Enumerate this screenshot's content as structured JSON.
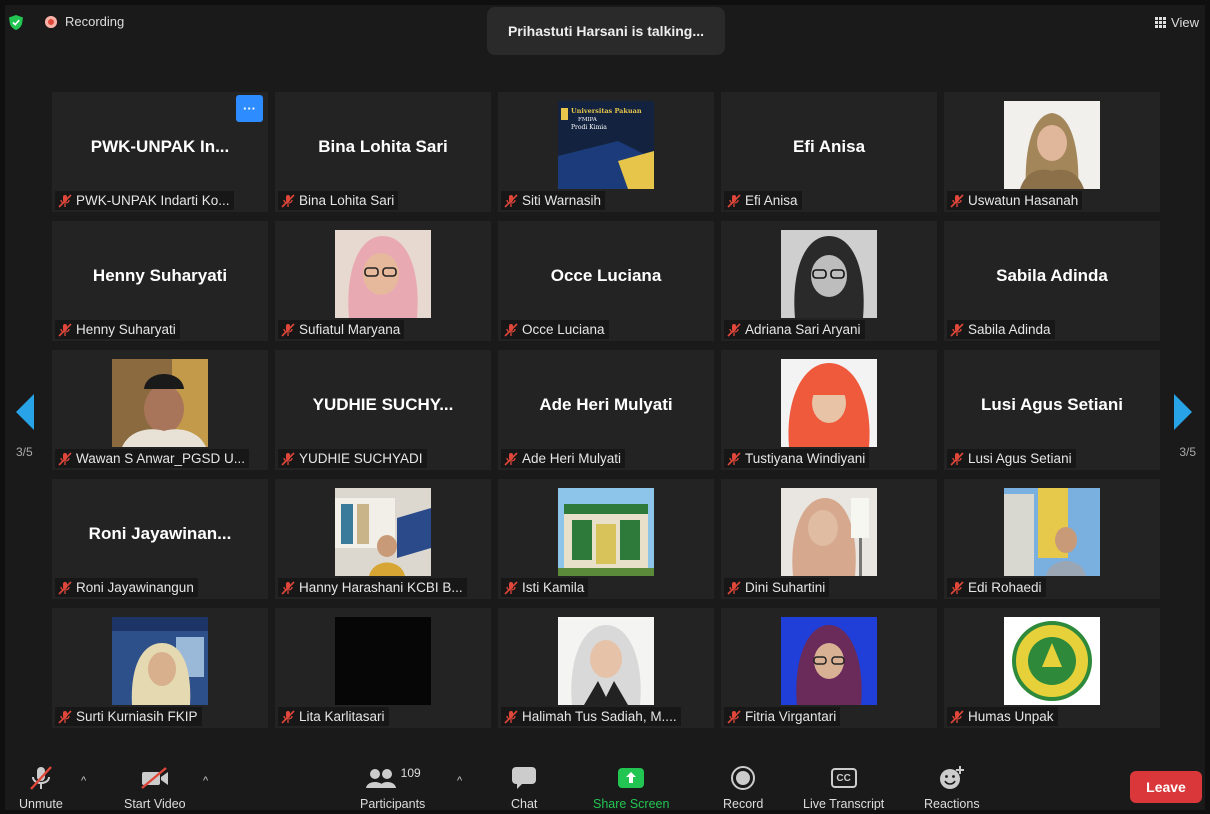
{
  "window": {
    "recording_label": "Recording",
    "speaker_banner": "Prihastuti Harsani is talking...",
    "view_label": "View"
  },
  "pagination": {
    "left": "3/5",
    "right": "3/5"
  },
  "colors": {
    "accent": "#2d8cff",
    "leave": "#d9373a",
    "share": "#23c552",
    "mic_muted": "#e0473a"
  },
  "participants": [
    {
      "display": "PWK-UNPAK  In...",
      "label": "PWK-UNPAK  Indarti Ko..."
    },
    {
      "display": "Bina Lohita Sari",
      "label": "Bina Lohita Sari"
    },
    {
      "display": "",
      "label": "Siti Warnasih",
      "video_text": [
        "Universitas Pakuan",
        "FMIPA",
        "Prodi Kimia"
      ]
    },
    {
      "display": "Efi Anisa",
      "label": "Efi Anisa"
    },
    {
      "display": "",
      "label": "Uswatun Hasanah"
    },
    {
      "display": "Henny Suharyati",
      "label": "Henny Suharyati"
    },
    {
      "display": "",
      "label": "Sufiatul Maryana"
    },
    {
      "display": "Occe Luciana",
      "label": "Occe Luciana"
    },
    {
      "display": "",
      "label": "Adriana Sari Aryani"
    },
    {
      "display": "Sabila Adinda",
      "label": "Sabila Adinda"
    },
    {
      "display": "",
      "label": "Wawan S Anwar_PGSD U..."
    },
    {
      "display": "YUDHIE  SUCHY...",
      "label": "YUDHIE SUCHYADI"
    },
    {
      "display": "Ade Heri Mulyati",
      "label": "Ade Heri Mulyati"
    },
    {
      "display": "",
      "label": "Tustiyana Windiyani"
    },
    {
      "display": "Lusi Agus Setiani",
      "label": "Lusi Agus Setiani"
    },
    {
      "display": "Roni  Jayawinan...",
      "label": "Roni Jayawinangun"
    },
    {
      "display": "",
      "label": "Hanny Harashani KCBI B..."
    },
    {
      "display": "",
      "label": "Isti Kamila"
    },
    {
      "display": "",
      "label": "Dini Suhartini"
    },
    {
      "display": "",
      "label": "Edi Rohaedi"
    },
    {
      "display": "",
      "label": "Surti Kurniasih FKIP"
    },
    {
      "display": "",
      "label": "Lita Karlitasari"
    },
    {
      "display": "",
      "label": "Halimah Tus Sadiah, M...."
    },
    {
      "display": "",
      "label": "Fitria Virgantari"
    },
    {
      "display": "",
      "label": "Humas Unpak"
    }
  ],
  "toolbar": {
    "unmute": "Unmute",
    "start_video": "Start Video",
    "participants": "Participants",
    "participants_count": "109",
    "chat": "Chat",
    "share_screen": "Share Screen",
    "record": "Record",
    "live_transcript": "Live Transcript",
    "cc": "CC",
    "reactions": "Reactions",
    "leave": "Leave"
  }
}
